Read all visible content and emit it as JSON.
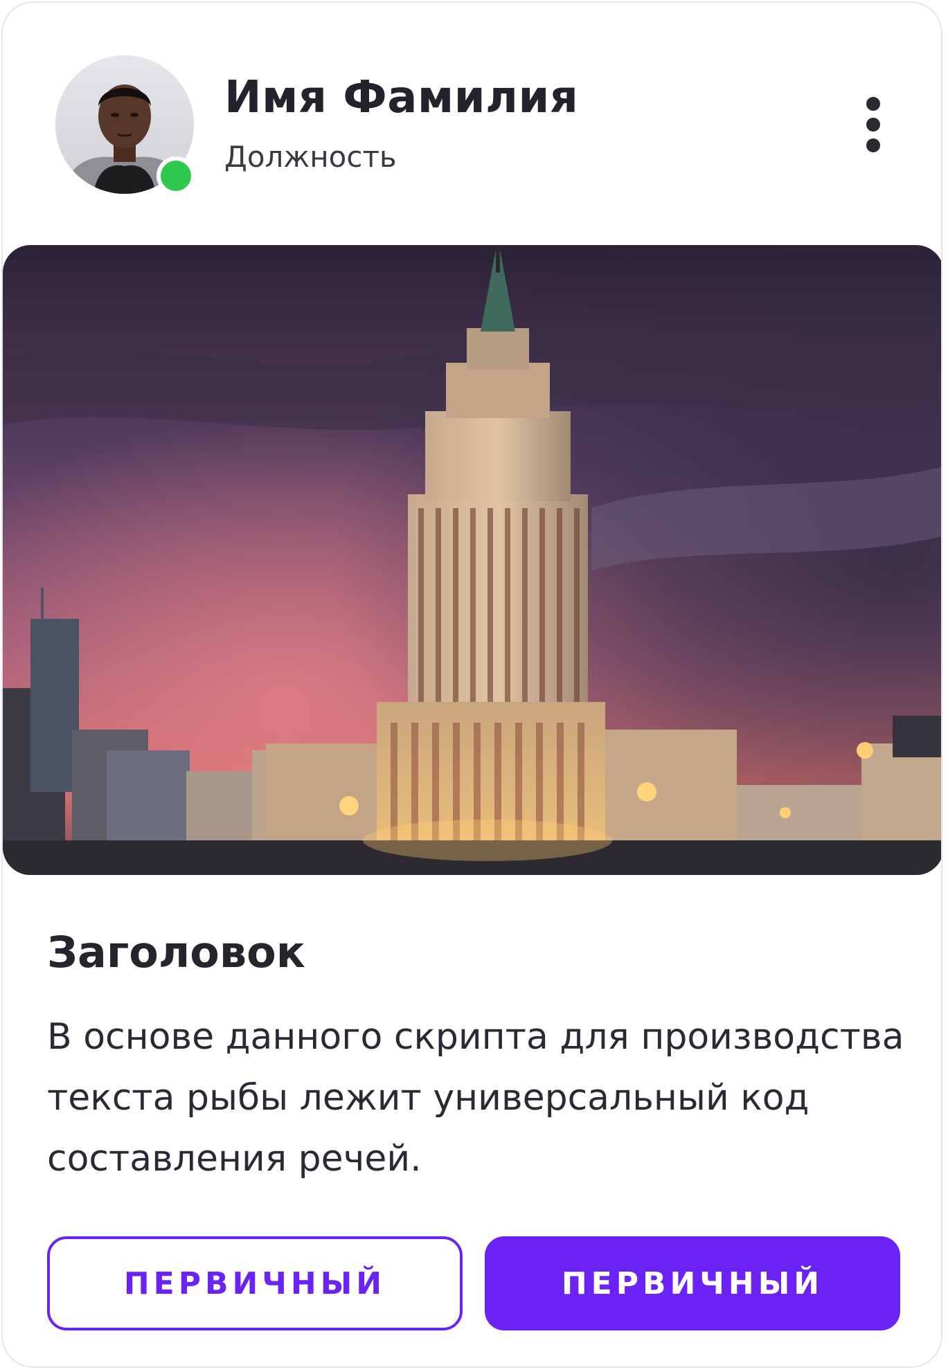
{
  "header": {
    "name": "Имя Фамилия",
    "role": "Должность",
    "status": "online",
    "avatar_icon": "user-photo",
    "menu_icon": "more-vertical-icon"
  },
  "media": {
    "description_icon": "photo-skyscraper"
  },
  "content": {
    "title": "Заголовок",
    "body": "В основе данного скрипта для производства текста рыбы лежит универсальный код составления речей."
  },
  "actions": {
    "secondary_label": "ПЕРВИЧНЫЙ",
    "primary_label": "ПЕРВИЧНЫЙ"
  },
  "colors": {
    "accent": "#6a22f5",
    "status_online": "#2ec94d",
    "text": "#25252e",
    "border": "#e4e6ec"
  }
}
